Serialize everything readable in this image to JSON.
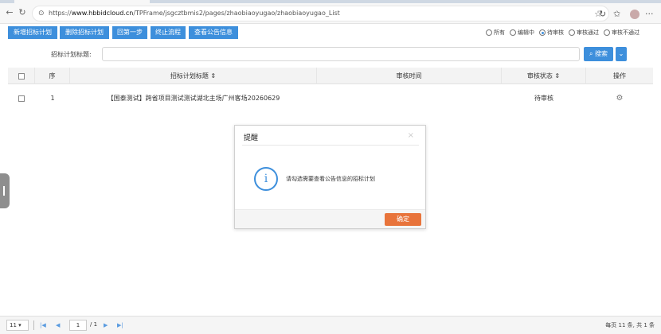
{
  "browser": {
    "url_prefix": "https://",
    "url_domain": "www.hbbidcloud.cn",
    "url_path": "/TPFrame/jsgcztbmis2/pages/zhaobiaoyugao/zhaobiaoyugao_List",
    "more_label": "···"
  },
  "toolbar": {
    "buttons": [
      "新增招标计划",
      "删除招标计划",
      "回第一步",
      "终止流程",
      "查看公告信息"
    ],
    "filters": [
      {
        "label": "所有",
        "checked": false
      },
      {
        "label": "编辑中",
        "checked": false
      },
      {
        "label": "待审核",
        "checked": true
      },
      {
        "label": "审核通过",
        "checked": false
      },
      {
        "label": "审核不通过",
        "checked": false
      }
    ]
  },
  "search": {
    "label": "招标计划标题:",
    "value": "",
    "button_label": "搜索"
  },
  "grid": {
    "columns": [
      "序",
      "招标计划标题",
      "审核时间",
      "审核状态",
      "操作"
    ],
    "rows": [
      {
        "index": "1",
        "title": "【国泰测试】跨省项目测试测试湖北主场广州客场20260629",
        "review_time": "",
        "status": "待审核"
      }
    ]
  },
  "dialog": {
    "title": "提醒",
    "close_label": "×",
    "message": "请勾选需要查看公告信息的招标计划",
    "info_glyph": "i",
    "ok_label": "确定"
  },
  "pager": {
    "page_size": "11",
    "current_page": "1",
    "total_pages": "/ 1",
    "info": "每页 11 条, 共 1 条"
  },
  "colors": {
    "primary": "#3d8fdc",
    "confirm": "#e8743b"
  }
}
